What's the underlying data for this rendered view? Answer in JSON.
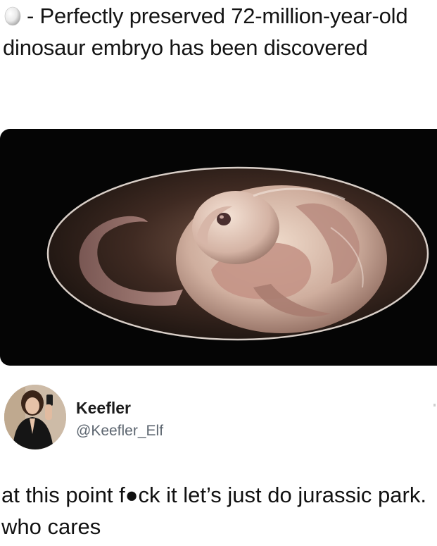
{
  "caption": {
    "icon": "egg-icon",
    "text": "- Perfectly preserved 72-million-year-old dinosaur embryo has been discovered"
  },
  "image": {
    "subject": "dinosaur-embryo-image"
  },
  "tweet": {
    "display_name": "Keefler",
    "handle": "@Keefler_Elf",
    "body": "at this point f●ck it let’s just do jurassic park. who cares"
  },
  "colors": {
    "text": "#111111",
    "handle": "#5d6670",
    "panel_bg": "#050505",
    "embryo_skin": "#c99f93"
  }
}
